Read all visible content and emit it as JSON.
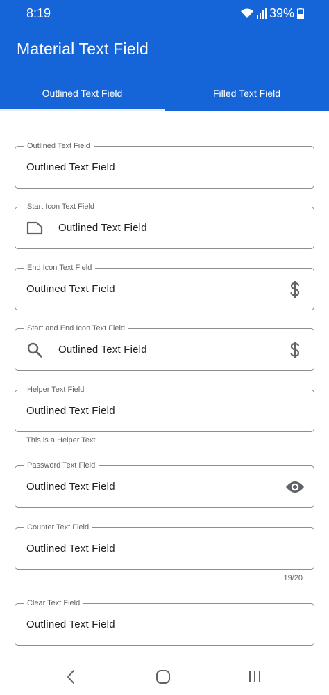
{
  "status_bar": {
    "time": "8:19",
    "battery": "39%"
  },
  "app_bar": {
    "title": "Material Text Field"
  },
  "tabs": [
    {
      "label": "Outlined Text Field",
      "selected": true
    },
    {
      "label": "Filled Text Field",
      "selected": false
    }
  ],
  "fields": [
    {
      "label": "Outlined Text Field",
      "value": "Outlined Text Field"
    },
    {
      "label": "Start Icon Text Field",
      "value": "Outlined Text Field",
      "start_icon": "label-icon"
    },
    {
      "label": "End Icon Text Field",
      "value": "Outlined Text Field",
      "end_icon": "dollar-icon"
    },
    {
      "label": "Start and End Icon Text Field",
      "value": "Outlined Text Field",
      "start_icon": "search-icon",
      "end_icon": "dollar-icon"
    },
    {
      "label": "Helper Text Field",
      "value": "Outlined Text Field",
      "helper_text": "This is a Helper Text"
    },
    {
      "label": "Password Text Field",
      "value": "Outlined Text Field",
      "end_icon": "eye-icon"
    },
    {
      "label": "Counter Text Field",
      "value": "Outlined Text Field",
      "counter": "19/20"
    },
    {
      "label": "Clear Text Field",
      "value": "Outlined Text Field"
    }
  ],
  "nav_bar": {
    "icons": [
      "back-icon",
      "home-icon",
      "recents-icon"
    ]
  },
  "colors": {
    "app_bar": "#1565d8",
    "outline": "#8e8e8e",
    "text": "#202124",
    "secondary_text": "#5f6368"
  }
}
